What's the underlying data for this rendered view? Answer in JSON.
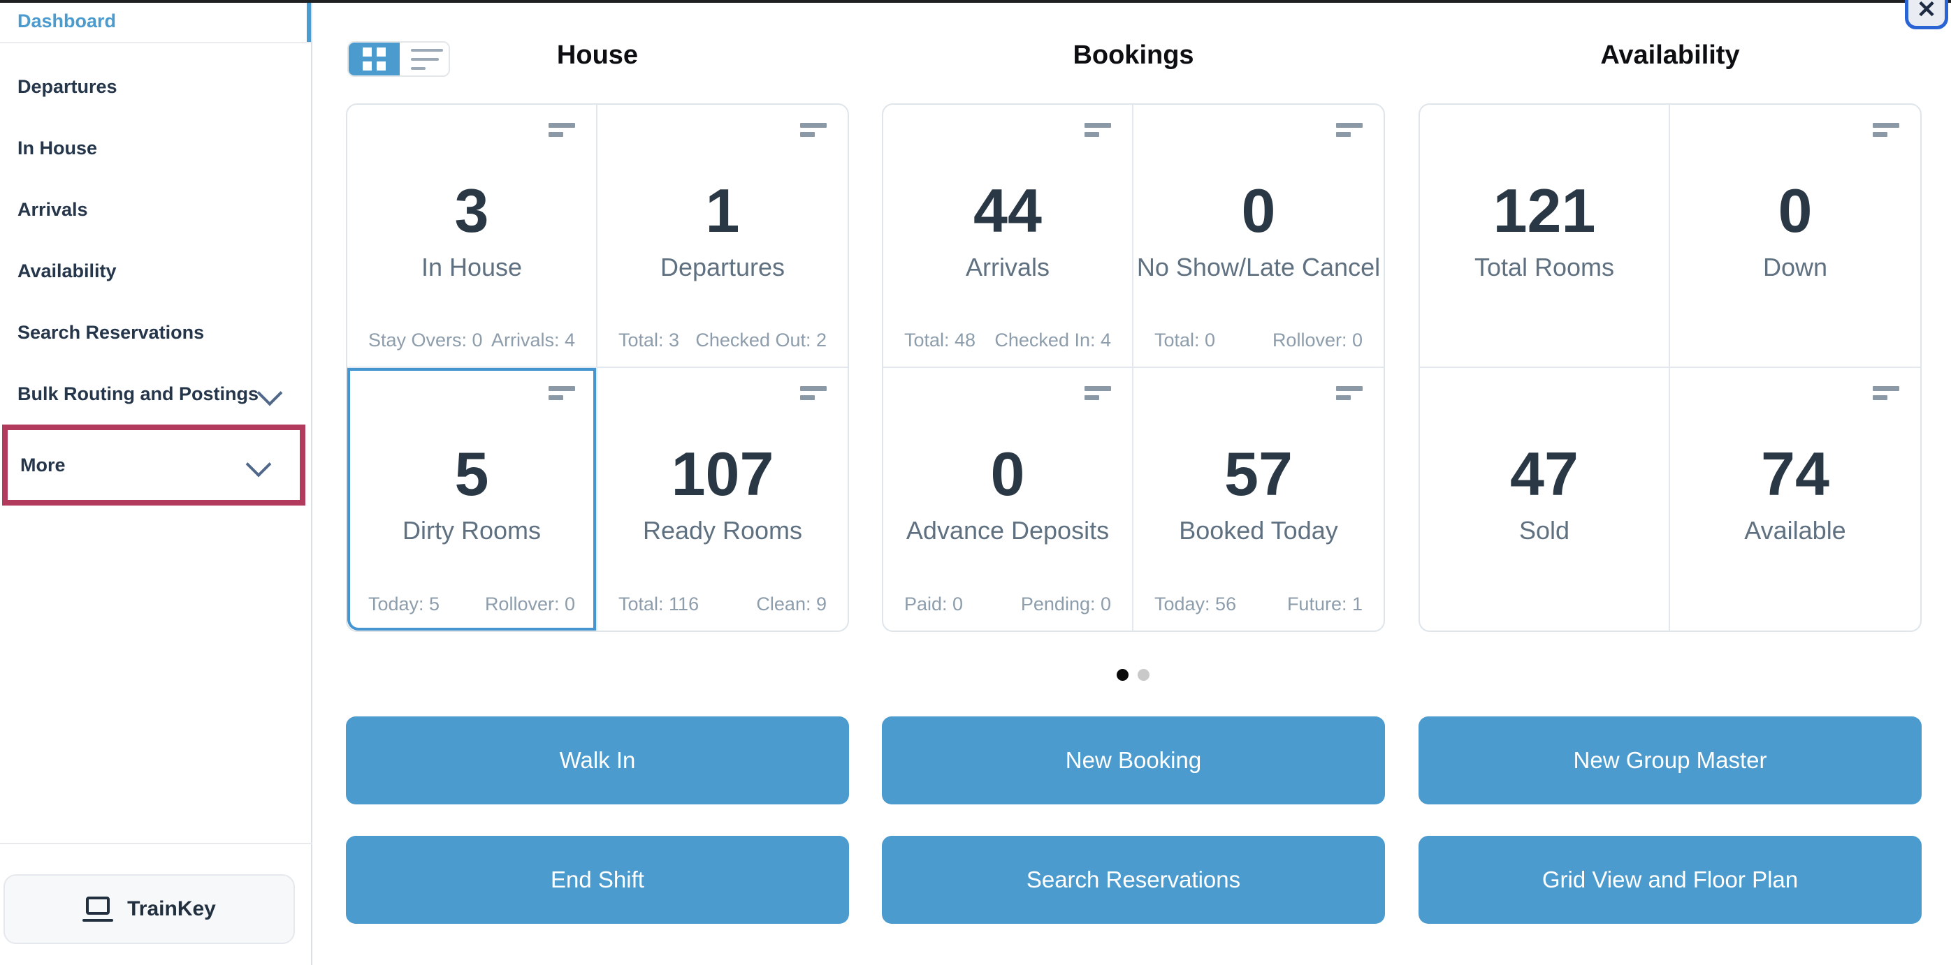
{
  "colors": {
    "accent": "#4c9bce",
    "highlight": "#b23a5c"
  },
  "window": {
    "close_glyph": "✕"
  },
  "sidebar": {
    "items": [
      {
        "label": "Dashboard"
      },
      {
        "label": "Departures"
      },
      {
        "label": "In House"
      },
      {
        "label": "Arrivals"
      },
      {
        "label": "Availability"
      },
      {
        "label": "Search Reservations"
      },
      {
        "label": "Bulk Routing and Postings"
      },
      {
        "label": "More"
      }
    ],
    "trainkey_label": "TrainKey"
  },
  "columns": [
    {
      "title": "House",
      "cards": [
        {
          "value": "3",
          "label": "In House",
          "footer_left": "Stay Overs: 0",
          "footer_right": "Arrivals: 4"
        },
        {
          "value": "1",
          "label": "Departures",
          "footer_left": "Total: 3",
          "footer_right": "Checked Out: 2"
        },
        {
          "value": "5",
          "label": "Dirty Rooms",
          "footer_left": "Today: 5",
          "footer_right": "Rollover: 0"
        },
        {
          "value": "107",
          "label": "Ready Rooms",
          "footer_left": "Total: 116",
          "footer_right": "Clean: 9"
        }
      ],
      "buttons": [
        "Walk In",
        "End Shift"
      ]
    },
    {
      "title": "Bookings",
      "cards": [
        {
          "value": "44",
          "label": "Arrivals",
          "footer_left": "Total: 48",
          "footer_right": "Checked In: 4"
        },
        {
          "value": "0",
          "label": "No Show/Late Cancel",
          "footer_left": "Total: 0",
          "footer_right": "Rollover: 0"
        },
        {
          "value": "0",
          "label": "Advance Deposits",
          "footer_left": "Paid: 0",
          "footer_right": "Pending: 0"
        },
        {
          "value": "57",
          "label": "Booked Today",
          "footer_left": "Today: 56",
          "footer_right": "Future: 1"
        }
      ],
      "buttons": [
        "New Booking",
        "Search Reservations"
      ]
    },
    {
      "title": "Availability",
      "cards": [
        {
          "value": "121",
          "label": "Total Rooms"
        },
        {
          "value": "0",
          "label": "Down"
        },
        {
          "value": "47",
          "label": "Sold"
        },
        {
          "value": "74",
          "label": "Available"
        }
      ],
      "buttons": [
        "New Group Master",
        "Grid View and Floor Plan"
      ]
    }
  ]
}
